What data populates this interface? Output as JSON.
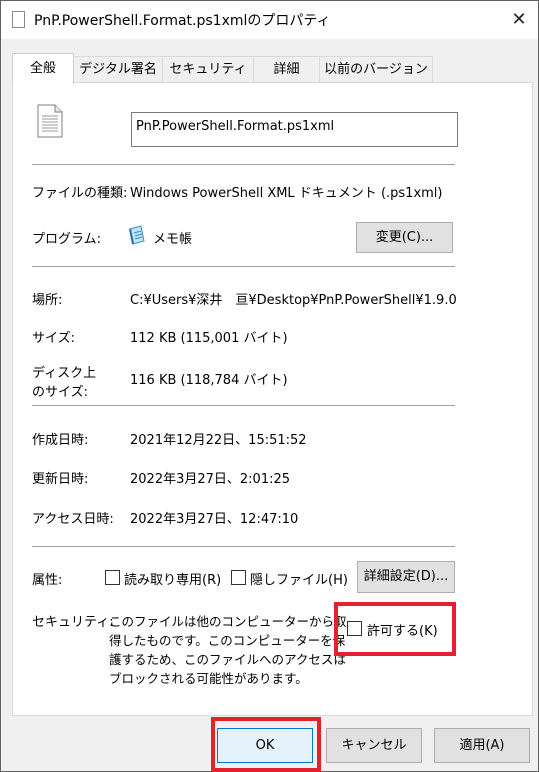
{
  "window": {
    "title": "PnP.PowerShell.Format.ps1xmlのプロパティ",
    "close_glyph": "✕"
  },
  "tabs": [
    {
      "label": "全般"
    },
    {
      "label": "デジタル署名"
    },
    {
      "label": "セキュリティ"
    },
    {
      "label": "詳細"
    },
    {
      "label": "以前のバージョン"
    }
  ],
  "general": {
    "file_name": "PnP.PowerShell.Format.ps1xml",
    "file_type_label": "ファイルの種類:",
    "file_type_value": "Windows PowerShell XML ドキュメント (.ps1xml)",
    "program_label": "プログラム:",
    "program_value": "メモ帳",
    "change_button": "変更(C)...",
    "location_label": "場所:",
    "location_value": "C:¥Users¥深井　亘¥Desktop¥PnP.PowerShell¥1.9.0",
    "size_label": "サイズ:",
    "size_value": "112 KB (115,001 バイト)",
    "size_on_disk_label_1": "ディスク上",
    "size_on_disk_label_2": "のサイズ:",
    "size_on_disk_value": "116 KB (118,784 バイト)",
    "created_label": "作成日時:",
    "created_value": "2021年12月22日、15:51:52",
    "modified_label": "更新日時:",
    "modified_value": "2022年3月27日、2:01:25",
    "accessed_label": "アクセス日時:",
    "accessed_value": "2022年3月27日、12:47:10",
    "attributes_label": "属性:",
    "readonly_label": "読み取り専用(R)",
    "hidden_label": "隠しファイル(H)",
    "advanced_button": "詳細設定(D)...",
    "security_label": "セキュリティ:",
    "security_text_1": "このファイルは他のコンピューターから取",
    "security_text_2": "得したものです。このコンピューターを保",
    "security_text_3": "護するため、このファイルへのアクセスは",
    "security_text_4": "ブロックされる可能性があります。",
    "unblock_label": "許可する(K)"
  },
  "footer": {
    "ok": "OK",
    "cancel": "キャンセル",
    "apply": "適用(A)"
  },
  "highlight_color": "#e4222e"
}
